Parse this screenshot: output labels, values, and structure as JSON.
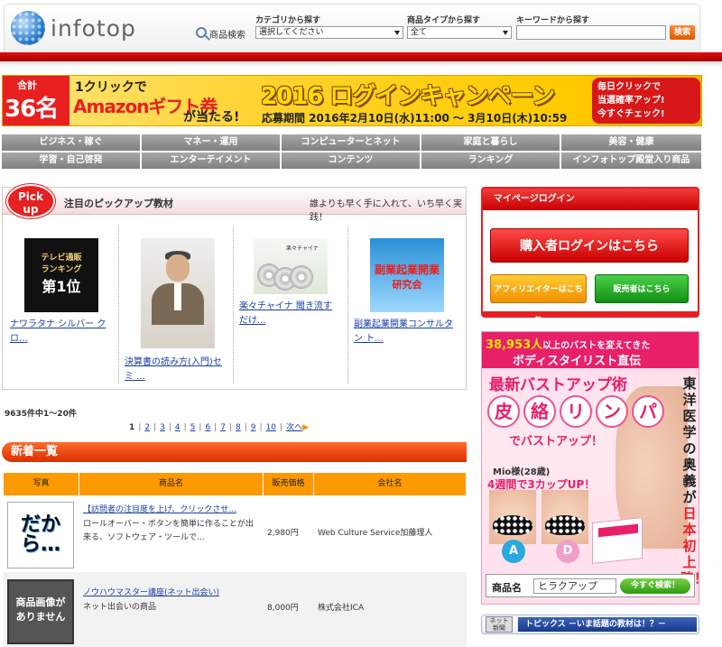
{
  "header": {
    "logo_text": "infotop",
    "search_label": "商品検索",
    "category_label": "カテゴリから探す",
    "category_value": "選択してください",
    "type_label": "商品タイプから探す",
    "type_value": "全て",
    "keyword_label": "キーワードから探す",
    "keyword_value": "",
    "search_button": "検索"
  },
  "banner": {
    "total_small": "合計",
    "total_big": "36名",
    "click": "1クリックで",
    "amazon": "Amazonギフト券",
    "win": "が当たる!",
    "campaign": "2016 ログインキャンペーン",
    "period": "応募期間 2016年2月10日(水)11:00 ～ 3月10日(木)10:59",
    "cta_line1": "毎日クリックで",
    "cta_line2": "当選確率アップ!",
    "cta_line3": "今すぐチェック!"
  },
  "nav": [
    "ビジネス・稼ぐ",
    "マネー・運用",
    "コンピューターとネット",
    "家庭と暮らし",
    "美容・健康",
    "学習・自己啓発",
    "エンターテイメント",
    "コンテンツ",
    "ランキング",
    "インフォトップ殿堂入り商品"
  ],
  "pickup": {
    "badge_line1": "Pick",
    "badge_line2": "up",
    "title": "注目のピックアップ教材",
    "subtitle": "誰よりも早く手に入れて、いち早く実践！",
    "items": [
      {
        "thumb_line1": "テレビ通販",
        "thumb_line2": "ランキング",
        "thumb_line3": "第1位",
        "link": "ナワラタナ シルバー クロ..."
      },
      {
        "link": "決算書の読み方(入門)セミ ..."
      },
      {
        "thumb_line1": "楽々チャイナ",
        "link": "楽々チャイナ 聞き流すだけ..."
      },
      {
        "thumb_line1": "副業起業開業",
        "thumb_line2": "研究会",
        "link": "副業起業開業コンサルタン ト..."
      }
    ]
  },
  "results": {
    "count": "9635件中1〜20件",
    "pages": [
      "1",
      "2",
      "3",
      "4",
      "5",
      "6",
      "7",
      "8",
      "9",
      "10"
    ],
    "next": "次へ"
  },
  "new_list": {
    "title": "新着一覧",
    "headers": [
      "写真",
      "商品名",
      "販売価格",
      "会社名"
    ],
    "rows": [
      {
        "thumb_text": "だから…",
        "name": "【訪問者の注目度を上げ、クリックさせ...",
        "desc": "ロールオーバー・ボタンを簡単に作ることが出来る、ソフトウェア・ツールで...",
        "price": "2,980円",
        "company": "Web Culture Service加藤理人"
      },
      {
        "thumb_text": "商品画像がありません",
        "thumb_line1": "商品画像が",
        "thumb_line2": "ありません",
        "name": "ノウハウマスター講座(ネット出会い)",
        "desc": "ネット出会いの商品",
        "price": "8,000円",
        "company": "株式会社ICA"
      }
    ]
  },
  "mypage": {
    "title": "マイページログイン",
    "buyer_button": "購入者ログインはこちら",
    "affiliate_button": "アフィリエイターはこちら",
    "seller_button": "販売者はこちら"
  },
  "ad": {
    "top_number": "38,953人",
    "top_rest": "以上のバストを変えてきた",
    "top_line2": "ボディスタイリスト直伝",
    "headline": "最新バストアップ術",
    "circles": [
      "皮",
      "絡",
      "リ",
      "ン",
      "パ"
    ],
    "bust": "でバストアップ！",
    "vertical_1": "東洋医学の奥義が",
    "vertical_2": "日本初上陸",
    "vertical_3": "！",
    "mio": "Mio様(28歳)",
    "weeks": "4週間で3カップUP！",
    "cup_a": "A",
    "cup_d": "D",
    "search_label": "商品名",
    "search_value": "ヒラクアップ",
    "search_button": "今すぐ検索！"
  },
  "topics": {
    "icon_text": "ネット 新聞",
    "label": "トピックス －いま話題の教材は！？－"
  }
}
